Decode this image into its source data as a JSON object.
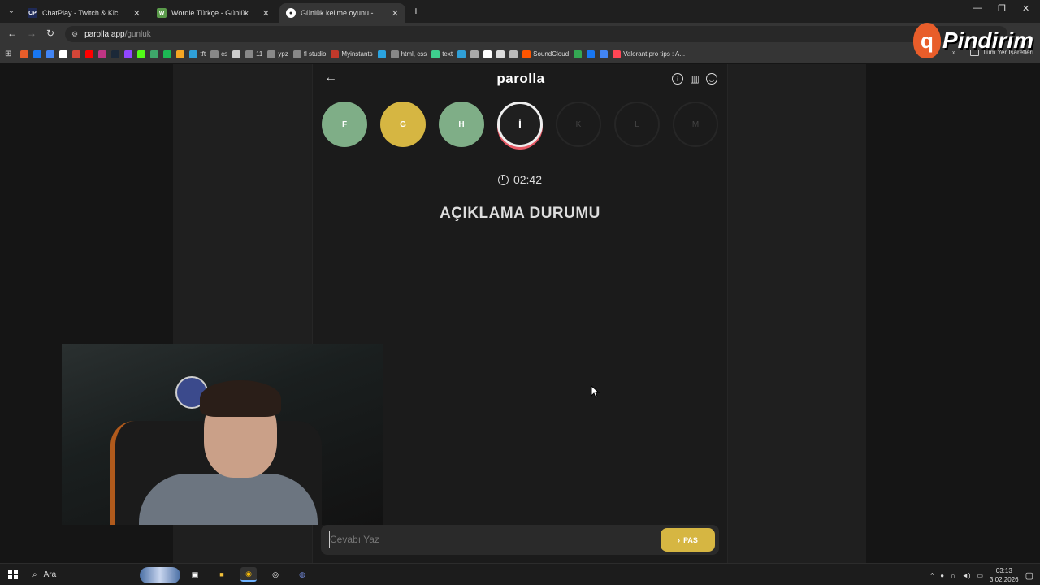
{
  "browser": {
    "tabs": [
      {
        "label": "ChatPlay - Twitch & Kick İzleyici",
        "favicon": "CP",
        "color": "#1f2a57",
        "active": false
      },
      {
        "label": "Wordle Türkçe - Günlük Kelime",
        "favicon": "W",
        "color": "#5a9a4a",
        "active": false
      },
      {
        "label": "Günlük kelime oyunu - parolla",
        "favicon": "●",
        "color": "#ffffff",
        "active": true
      }
    ],
    "new_tab": "+",
    "window_controls": {
      "minimize": "—",
      "restore": "❐",
      "close": "✕"
    },
    "url_host": "parolla.app",
    "url_path": "/gunluk",
    "bookmarks": [
      {
        "label": "",
        "color": "#e85d2a"
      },
      {
        "label": "",
        "color": "#1877f2"
      },
      {
        "label": "",
        "color": "#4285f4"
      },
      {
        "label": "",
        "color": "#ffffff"
      },
      {
        "label": "",
        "color": "#d44638"
      },
      {
        "label": "",
        "color": "#ff0000"
      },
      {
        "label": "",
        "color": "#c13584"
      },
      {
        "label": "",
        "color": "#1b2838"
      },
      {
        "label": "",
        "color": "#9146ff"
      },
      {
        "label": "",
        "color": "#53fc18"
      },
      {
        "label": "",
        "color": "#3ea76a"
      },
      {
        "label": "",
        "color": "#1db954"
      },
      {
        "label": "",
        "color": "#f5a623"
      },
      {
        "label": "tft",
        "color": "#2f9fd7"
      },
      {
        "label": "cs",
        "color": "#888888"
      },
      {
        "label": "",
        "color": "#cccccc"
      },
      {
        "label": "11",
        "color": "#888888"
      },
      {
        "label": "ypz",
        "color": "#888888"
      },
      {
        "label": "fl studio",
        "color": "#888888"
      },
      {
        "label": "Myinstants",
        "color": "#c0392b"
      },
      {
        "label": "",
        "color": "#2aa3e0"
      },
      {
        "label": "html, css",
        "color": "#888888"
      },
      {
        "label": "text",
        "color": "#3ecf8e"
      },
      {
        "label": "",
        "color": "#2f9fd7"
      },
      {
        "label": "",
        "color": "#aaaaaa"
      },
      {
        "label": "",
        "color": "#ffffff"
      },
      {
        "label": "",
        "color": "#dddddd"
      },
      {
        "label": "",
        "color": "#bbbbbb"
      },
      {
        "label": "SoundCloud",
        "color": "#ff5500"
      },
      {
        "label": "",
        "color": "#34a853"
      },
      {
        "label": "",
        "color": "#1877f2"
      },
      {
        "label": "",
        "color": "#4285f4"
      },
      {
        "label": "Valorant pro tips : A...",
        "color": "#ff4655"
      }
    ],
    "more_bookmarks": "»",
    "all_bookmarks": "Tüm Yer İşaretleri"
  },
  "overlay_logo": {
    "badge": "q",
    "word": "Pindirim"
  },
  "game": {
    "back": "←",
    "title": "parolla",
    "header_icons": [
      "info-icon",
      "stats-icon",
      "user-icon"
    ],
    "letters": [
      {
        "char": "F",
        "state": "green"
      },
      {
        "char": "G",
        "state": "yellow"
      },
      {
        "char": "H",
        "state": "green"
      },
      {
        "char": "İ",
        "state": "current"
      },
      {
        "char": "K",
        "state": "pending"
      },
      {
        "char": "L",
        "state": "pending"
      },
      {
        "char": "M",
        "state": "pending"
      }
    ],
    "timer": "02:42",
    "status": "AÇIKLAMA DURUMU",
    "answer_placeholder": "Cevabı Yaz",
    "pass_label": "PAS",
    "pass_icon": "›"
  },
  "taskbar": {
    "search": "Ara",
    "time": "03:13",
    "date": "3.02.2026"
  },
  "colors": {
    "green": "#7fae87",
    "yellow": "#d6b642",
    "ring": "#e85a66"
  }
}
